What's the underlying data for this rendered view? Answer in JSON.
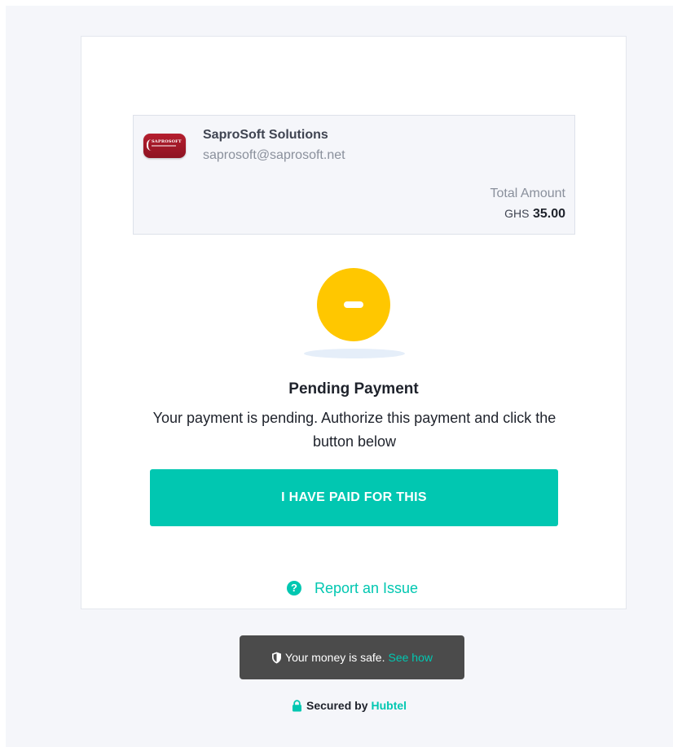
{
  "merchant": {
    "logo_text": "SAPROSOFT",
    "name": "SaproSoft Solutions",
    "email": "saprosoft@saprosoft.net"
  },
  "payment": {
    "total_label": "Total Amount",
    "currency": "GHS",
    "amount": "35.00"
  },
  "status": {
    "icon": "pending-dash-icon",
    "title": "Pending Payment",
    "message": "Your payment is pending. Authorize this payment and click the button below",
    "color": "#ffc700"
  },
  "actions": {
    "paid_button_label": "I HAVE PAID FOR THIS",
    "report_label": "Report an Issue",
    "report_icon": "question-circle-icon"
  },
  "footer": {
    "safe_text": "Your money is safe.",
    "see_how_label": "See how",
    "secured_prefix": "Secured by",
    "secured_brand": "Hubtel"
  },
  "colors": {
    "accent": "#01c7b1",
    "pending": "#ffc700",
    "badge_bg": "#4b4b4b",
    "page_bg": "#f5f6fa"
  }
}
